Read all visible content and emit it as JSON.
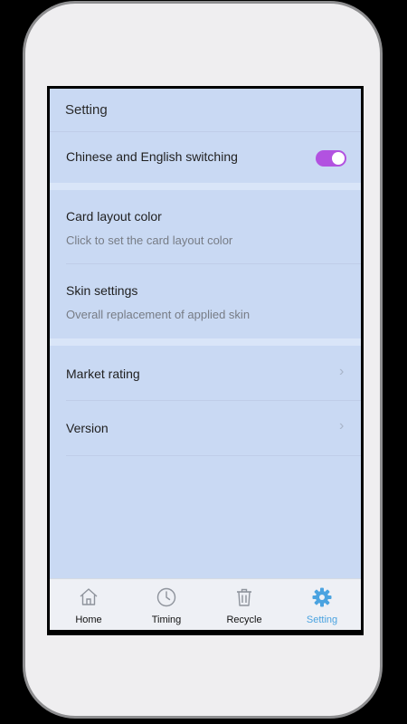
{
  "header": {
    "title": "Setting"
  },
  "settings": {
    "language": {
      "label": "Chinese and English switching",
      "enabled": true,
      "toggle_color": "#b252e0"
    },
    "card_layout": {
      "title": "Card layout color",
      "subtitle": "Click to set the card layout color"
    },
    "skin": {
      "title": "Skin settings",
      "subtitle": "Overall replacement of applied skin"
    },
    "market_rating": {
      "title": "Market rating",
      "chevron": "›"
    },
    "version": {
      "title": "Version",
      "chevron": "›"
    }
  },
  "tabbar": {
    "active_color": "#4ba3e0",
    "tabs": [
      {
        "label": "Home",
        "icon": "home-icon"
      },
      {
        "label": "Timing",
        "icon": "clock-icon"
      },
      {
        "label": "Recycle",
        "icon": "trash-icon"
      },
      {
        "label": "Setting",
        "icon": "gear-icon",
        "active": true
      }
    ]
  }
}
